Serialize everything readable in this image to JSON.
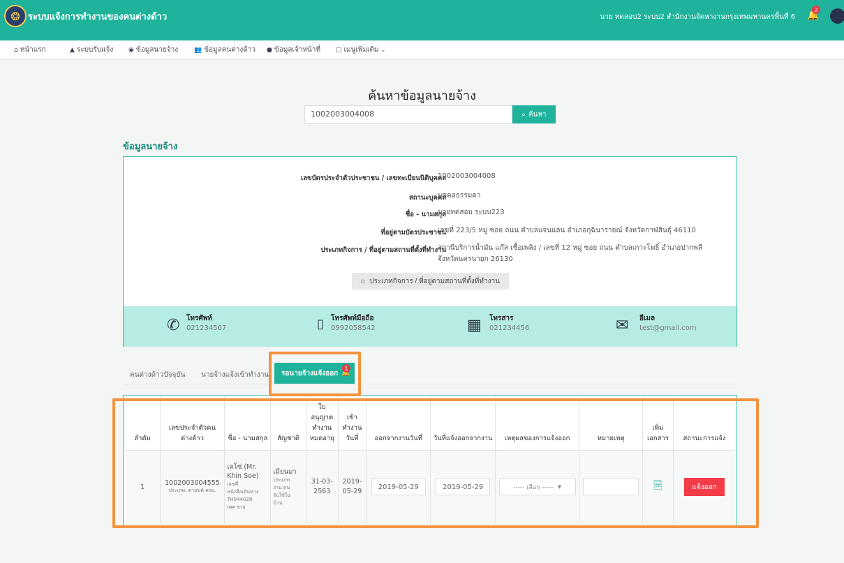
{
  "header": {
    "logo_icon": "government-seal-icon",
    "app_title": "ระบบแจ้งการทำงานของคนต่างด้าว",
    "user_info": "นาย ทดสอบ2 ระบบ2 สำนักงานจัดหางานกรุงเทพมหานครพื้นที่ 6",
    "notification_count": "2"
  },
  "menu": {
    "items": [
      {
        "icon": "home-icon",
        "label": "หน้าแรก"
      },
      {
        "icon": "bell-icon",
        "label": "ระบบรับแจ้ง"
      },
      {
        "icon": "employer-icon",
        "label": "ข้อมูลนายจ้าง"
      },
      {
        "icon": "users-icon",
        "label": "ข้อมูลคนต่างด้าว"
      },
      {
        "icon": "user-icon",
        "label": "ข้อมูลเจ้าหน้าที่"
      },
      {
        "icon": "document-icon",
        "label": "เมนูเพิ่มเติม"
      }
    ]
  },
  "search": {
    "title": "ค้นหาข้อมูลนายจ้าง",
    "value": "1002003004008",
    "button_label": "ค้นหา"
  },
  "employer": {
    "section_title": "ข้อมูลนายจ้าง",
    "rows": [
      {
        "label": "เลขบัตรประจำตัวประชาชน / เลขทะเบียนนิติบุคคล",
        "value": "1002003004008"
      },
      {
        "label": "สถานะบุคคล",
        "value": "บุคคลธรรมดา"
      },
      {
        "label": "ชื่อ - นามสกุล",
        "value": "นายทดสอบ ระบบ223"
      },
      {
        "label": "ที่อยู่ตามบัตรประชาชน",
        "value": "เลขที่ 223/5 หมู่ ซอย ถนน ตำบลแจนแลน อำเภอกุฉินารายณ์ จังหวัดกาฬสินธุ์ 46110"
      },
      {
        "label": "ประเภทกิจการ / ที่อยู่ตามสถานที่ตั้งที่ทำงาน",
        "value": "สถานีบริการน้ำมัน แก๊ส เชื้อเพลิง / เลขที่ 12 หมู่ ซอย ถนน ตำบลเกาะโพธิ์ อำเภอปากพลี จังหวัดนครนายก 26130"
      }
    ],
    "location_button": "ประเภทกิจการ / ที่อยู่ตามสถานที่ตั้งที่ทำงาน"
  },
  "contacts": [
    {
      "icon": "phone-icon",
      "label": "โทรศัพท์",
      "value": "021234567"
    },
    {
      "icon": "mobile-icon",
      "label": "โทรศัพท์มือถือ",
      "value": "0992058542"
    },
    {
      "icon": "fax-icon",
      "label": "โทรสาร",
      "value": "021234456"
    },
    {
      "icon": "email-icon",
      "label": "อีเมล",
      "value": "test@gmail.com"
    }
  ],
  "tabs": [
    {
      "label": "คนต่างด้าวปัจจุบัน"
    },
    {
      "label": "นายจ้างแจ้งเข้าทำงาน"
    },
    {
      "label": "รอนายจ้างแจ้งออก",
      "badge": "1",
      "active": true
    }
  ],
  "table": {
    "headers": [
      "ลำดับ",
      "เลขประจำตัวคนต่างด้าว",
      "ชื่อ - นามสกุล",
      "สัญชาติ",
      "ใบอนุญาตทำงานหมดอายุ",
      "เข้าทำงานวันที่",
      "ออกจากงานวันที่",
      "วันที่แจ้งออกจากงาน",
      "เหตุผลของการแจ้งออก",
      "หมายเหตุ",
      "เพิ่มเอกสาร",
      "สถานะการแจ้ง"
    ],
    "row": {
      "index": "1",
      "alien_id": "1002003004555",
      "alien_type": "ประเภท: ตามมติ ครม.",
      "name": "เคโซ่ (Mr. Khin Soe)",
      "doc_line1": "เลขที่",
      "doc_line2": "หนังสือเดินทาง",
      "doc_line3": "TH044028",
      "gender": "เพศ ชาย",
      "nationality": "เมียนมา",
      "nat_note1": "ประเภท",
      "nat_note2": "งาน คน",
      "nat_note3": "รับใช้ใน",
      "nat_note4": "บ้าน",
      "permit_expiry": "31-03-2563",
      "start_date": "2019-05-29",
      "leave_date": "2019-05-29",
      "notify_date": "2019-05-29",
      "reason_placeholder": "----- เลือก -----",
      "note": "",
      "exit_button": "แจ้งออก"
    }
  }
}
